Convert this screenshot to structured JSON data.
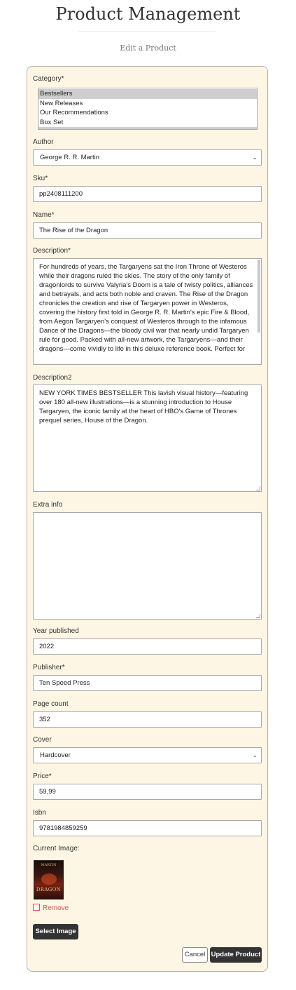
{
  "header": {
    "title": "Product Management",
    "subtitle": "Edit a Product"
  },
  "form": {
    "category": {
      "label": "Category*",
      "options": [
        "Bestsellers",
        "New Releases",
        "Our Recommendations",
        "Box Set"
      ],
      "selected": [
        "Bestsellers"
      ]
    },
    "author": {
      "label": "Author",
      "value": "George R. R. Martin"
    },
    "sku": {
      "label": "Sku*",
      "value": "pp2408111200"
    },
    "name": {
      "label": "Name*",
      "value": "The Rise of the Dragon"
    },
    "description": {
      "label": "Description*",
      "value": "For hundreds of years, the Targaryens sat the Iron Throne of Westeros while their dragons ruled the skies. The story of the only family of dragonlords to survive Valyria's Doom is a tale of twisty politics, alliances and betrayals, and acts both noble and craven. The Rise of the Dragon chronicles the creation and rise of Targaryen power in Westeros, covering the history first told in George R. R. Martin's epic Fire & Blood, from Aegon Targaryen's conquest of Westeros through to the infamous Dance of the Dragons—the bloody civil war that nearly undid Targaryen rule for good. Packed with all-new artwork, the Targaryens—and their dragons—come vividly to life in this deluxe reference book. Perfect for"
    },
    "description2": {
      "label": "Description2",
      "value": "NEW YORK TIMES BESTSELLER This lavish visual history—featuring over 180 all-new illustrations—is a stunning introduction to House Targaryen, the iconic family at the heart of HBO's Game of Thrones prequel series, House of the Dragon."
    },
    "extra_info": {
      "label": "Extra info",
      "value": ""
    },
    "year_published": {
      "label": "Year published",
      "value": "2022"
    },
    "publisher": {
      "label": "Publisher*",
      "value": "Ten Speed Press"
    },
    "page_count": {
      "label": "Page count",
      "value": "352"
    },
    "cover": {
      "label": "Cover",
      "value": "Hardcover"
    },
    "price": {
      "label": "Price*",
      "value": "59,99"
    },
    "isbn": {
      "label": "Isbn",
      "value": "9781984859259"
    },
    "current_image": {
      "label": "Current Image:",
      "thumb_top_text": "MARTIN",
      "thumb_bottom_text": "DRAGON"
    },
    "remove_label": "Remove",
    "select_image_label": "Select Image",
    "cancel_label": "Cancel",
    "update_label": "Update Product"
  },
  "colors": {
    "card_bg": "#fdf6e4",
    "dark_button": "#333333",
    "remove_red": "#d9534f",
    "selected_option": "#cecece"
  }
}
